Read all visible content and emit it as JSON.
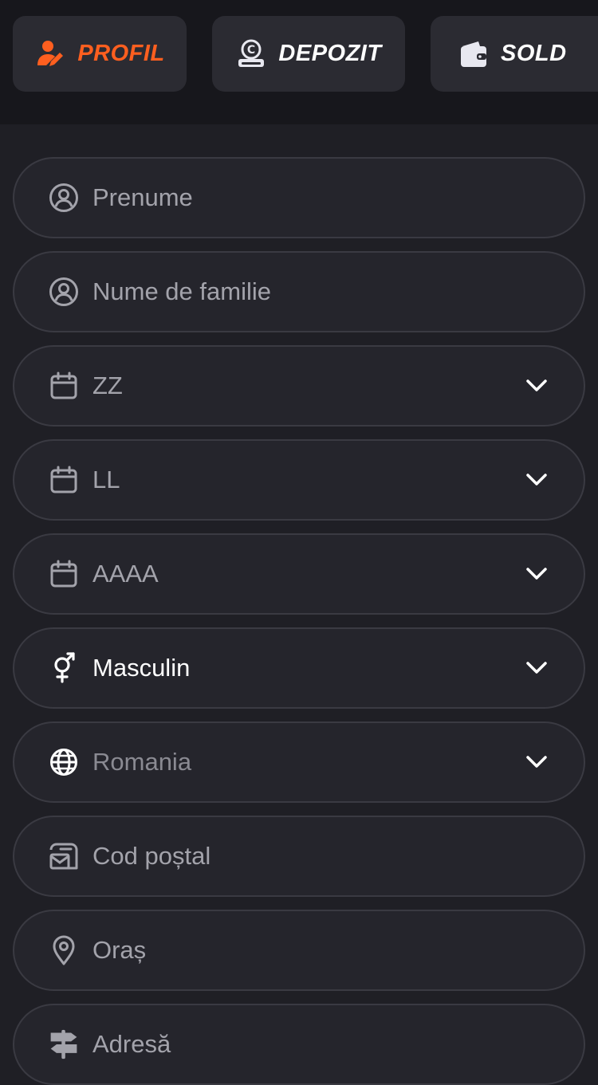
{
  "tabs": [
    {
      "label": "PROFIL",
      "icon": "user-edit-icon",
      "active": true
    },
    {
      "label": "DEPOZIT",
      "icon": "deposit-coin-icon",
      "active": false
    },
    {
      "label": "SOLD",
      "icon": "wallet-icon",
      "active": false
    }
  ],
  "form": {
    "first_name": {
      "placeholder": "Prenume",
      "icon": "user-circle-icon"
    },
    "last_name": {
      "placeholder": "Nume de familie",
      "icon": "user-circle-icon"
    },
    "day": {
      "value": "ZZ",
      "icon": "calendar-icon"
    },
    "month": {
      "value": "LL",
      "icon": "calendar-icon"
    },
    "year": {
      "value": "AAAA",
      "icon": "calendar-icon"
    },
    "gender": {
      "value": "Masculin",
      "icon": "gender-icon"
    },
    "country": {
      "value": "Romania",
      "icon": "globe-icon"
    },
    "postal_code": {
      "placeholder": "Cod poștal",
      "icon": "mailbox-icon"
    },
    "city": {
      "placeholder": "Oraș",
      "icon": "map-pin-icon"
    },
    "address": {
      "placeholder": "Adresă",
      "icon": "signpost-icon"
    }
  },
  "colors": {
    "accent": "#ff5f1f",
    "background": "#1f1f25",
    "header_bg": "#17171c",
    "field_bg": "#25252c",
    "field_border": "#3a3a42",
    "placeholder": "#a3a3ab",
    "value_text": "#ffffff"
  }
}
